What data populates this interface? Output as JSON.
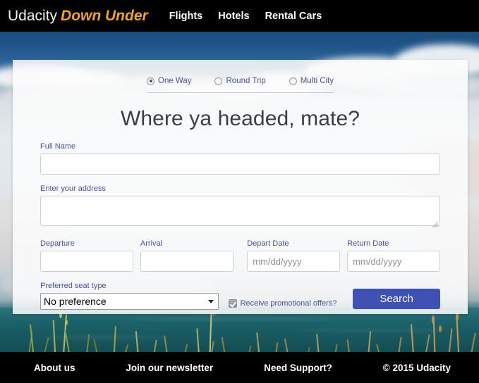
{
  "navbar": {
    "brand_primary": "Udacity",
    "brand_secondary": "Down Under",
    "links": [
      {
        "label": "Flights",
        "name": "nav-link-flights"
      },
      {
        "label": "Hotels",
        "name": "nav-link-hotels"
      },
      {
        "label": "Rental Cars",
        "name": "nav-link-rental-cars"
      }
    ]
  },
  "form": {
    "trip_types": [
      {
        "label": "One Way",
        "selected": true
      },
      {
        "label": "Round Trip",
        "selected": false
      },
      {
        "label": "Multi City",
        "selected": false
      }
    ],
    "headline": "Where ya headed, mate?",
    "full_name": {
      "label": "Full Name",
      "value": "",
      "placeholder": ""
    },
    "address": {
      "label": "Enter your address",
      "value": "",
      "placeholder": ""
    },
    "departure": {
      "label": "Departure",
      "value": "",
      "placeholder": ""
    },
    "arrival": {
      "label": "Arrival",
      "value": "",
      "placeholder": ""
    },
    "depart_date": {
      "label": "Depart Date",
      "value": "",
      "placeholder": "mm/dd/yyyy"
    },
    "return_date": {
      "label": "Return Date",
      "value": "",
      "placeholder": "mm/dd/yyyy"
    },
    "seat_type": {
      "label": "Preferred seat type",
      "selected": "No preference",
      "options": [
        "No preference"
      ]
    },
    "promo": {
      "label": "Receive promotional offers?",
      "checked": true
    },
    "search_button": "Search"
  },
  "footer": {
    "links": [
      {
        "label": "About us",
        "name": "footer-link-about-us"
      },
      {
        "label": "Join our newsletter",
        "name": "footer-link-newsletter"
      },
      {
        "label": "Need Support?",
        "name": "footer-link-support"
      }
    ],
    "copyright": "© 2015 Udacity"
  },
  "colors": {
    "navbar_bg": "#000000",
    "brand_accent": "#f0a51e",
    "label_text": "#4a4fa8",
    "button_primary": "#3f51b5",
    "panel_bg": "#fdfdfd",
    "headline_text": "#3a3f44"
  }
}
